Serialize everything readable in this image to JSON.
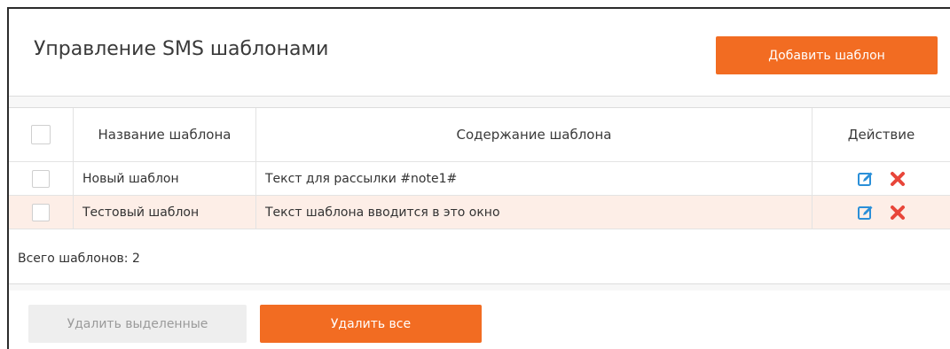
{
  "page": {
    "title": "Управление SMS шаблонами",
    "add_button_label": "Добавить шаблон"
  },
  "table": {
    "columns": {
      "name": "Название шаблона",
      "content": "Содержание шаблона",
      "action": "Действие"
    },
    "rows": [
      {
        "name": "Новый шаблон",
        "content": "Текст для рассылки #note1#",
        "edit_icon": "edit-icon",
        "delete_icon": "delete-icon"
      },
      {
        "name": "Тестовый шаблон",
        "content": "Текст шаблона вводится в это окно",
        "edit_icon": "edit-icon",
        "delete_icon": "delete-icon"
      }
    ]
  },
  "summary": {
    "total_text": "Всего шаблонов: 2"
  },
  "footer": {
    "delete_selected_label": "Удалить выделенные",
    "delete_all_label": "Удалить все"
  },
  "colors": {
    "accent": "#f26c22",
    "row_highlight": "#fdeee7",
    "edit_icon": "#2a8fd8",
    "delete_icon": "#e8463a",
    "disabled_button": "#eeeeee"
  }
}
